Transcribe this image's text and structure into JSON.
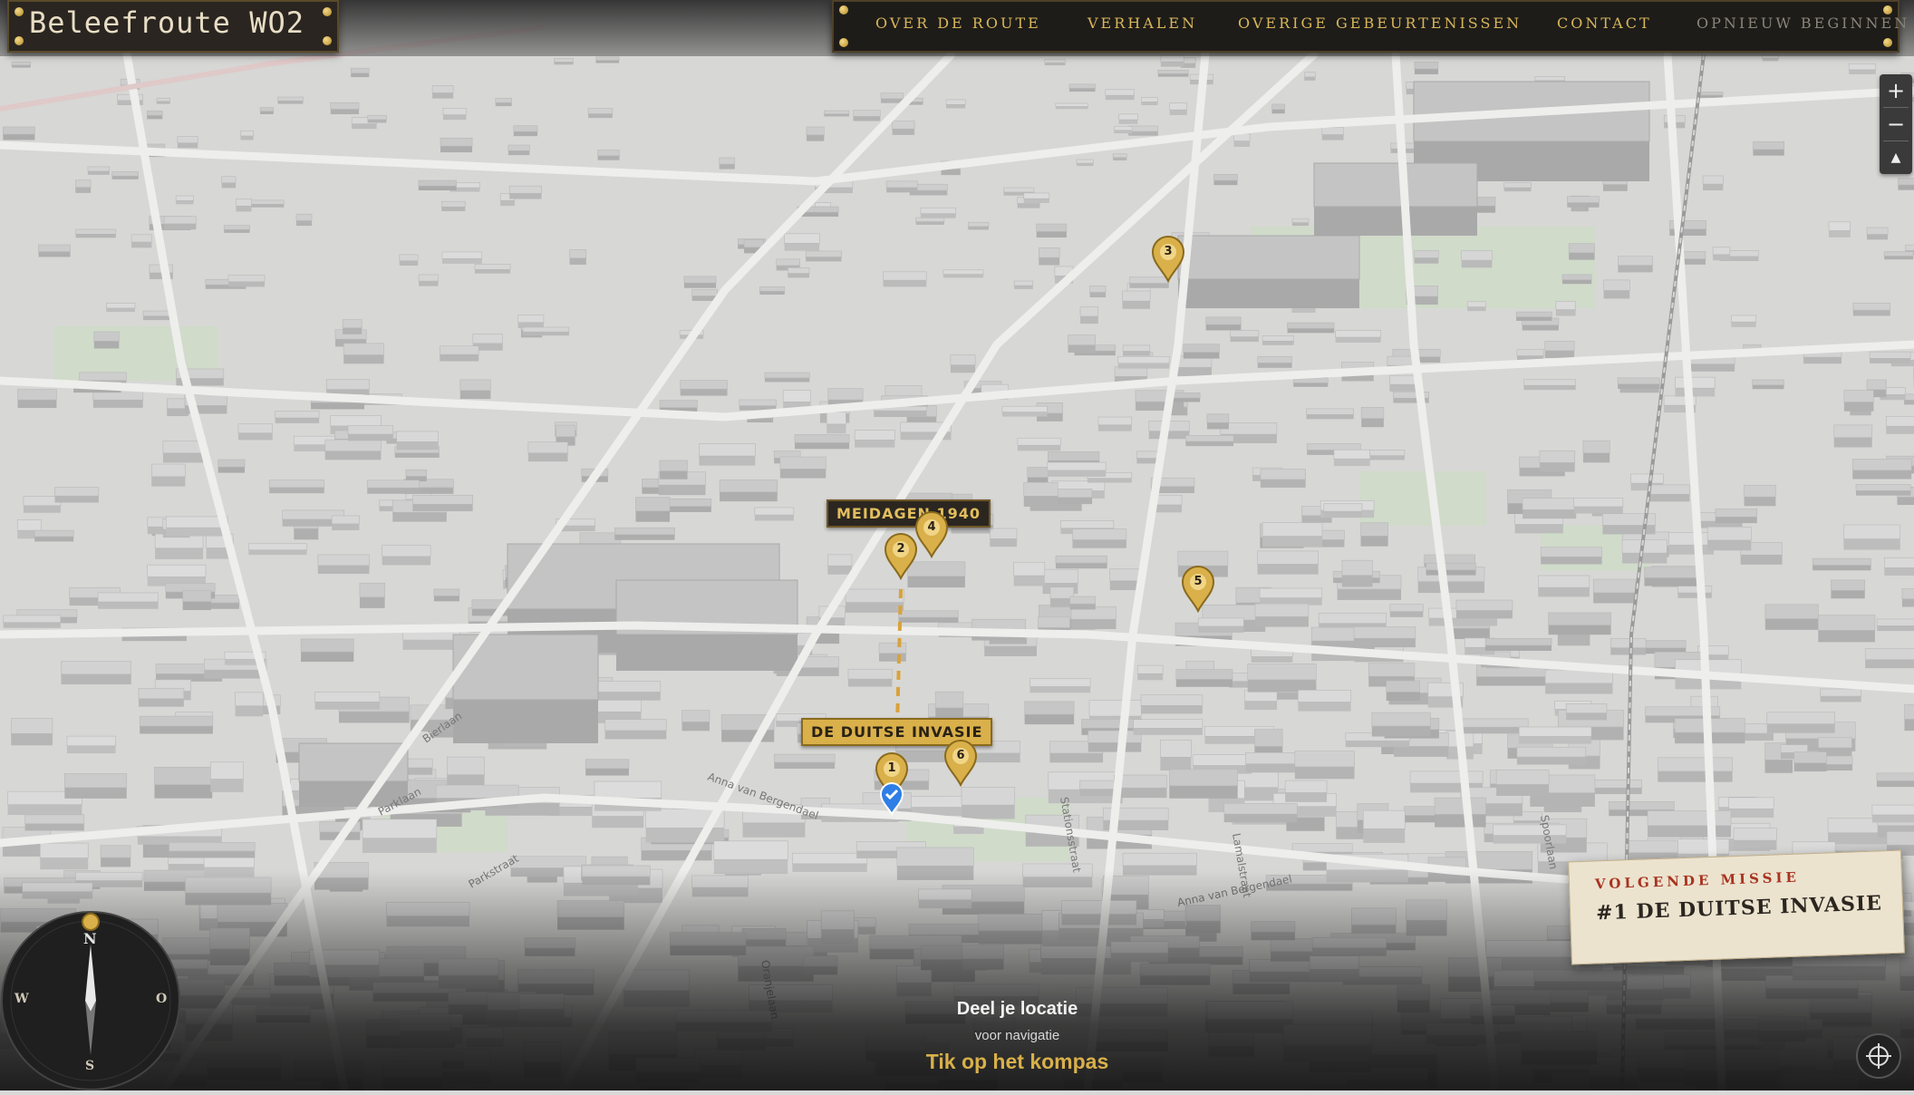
{
  "brand": {
    "title": "Beleefroute WO2"
  },
  "nav": {
    "items": [
      "OVER DE ROUTE",
      "VERHALEN",
      "OVERIGE GEBEURTENISSEN",
      "CONTACT",
      "OPNIEUW BEGINNEN"
    ]
  },
  "map_controls": {
    "zoom_in": "+",
    "zoom_out": "−",
    "reset_north": "▲"
  },
  "markers": [
    {
      "number": "1",
      "label": "DE DUITSE INVASIE"
    },
    {
      "number": "2"
    },
    {
      "number": "3"
    },
    {
      "number": "4",
      "label": "MEIDAGEN 1940"
    },
    {
      "number": "5"
    },
    {
      "number": "6"
    }
  ],
  "street_labels": [
    "Parklaan",
    "Anna van Bergendael",
    "Anna van Bergendael",
    "Oranjelaan",
    "Stationsstraat",
    "Lamalstraat",
    "Spoorlaan",
    "Bierlaan",
    "Parkstraat"
  ],
  "compass": {
    "north": "N",
    "west": "W",
    "east": "O",
    "south": "S"
  },
  "share_location": {
    "title": "Deel je locatie",
    "subtitle": "voor navigatie",
    "cta": "Tik op het kompas"
  },
  "next_mission": {
    "kicker": "VOLGENDE MISSIE",
    "title": "#1 DE DUITSE INVASIE"
  },
  "colors": {
    "accent_gold": "#d9b04a",
    "nav_bg": "#1e1c19",
    "mission_red": "#a8331f",
    "map_base": "#d8d8d8"
  },
  "icons": {
    "locate": "crosshair-icon",
    "user_location": "user-location-icon"
  }
}
